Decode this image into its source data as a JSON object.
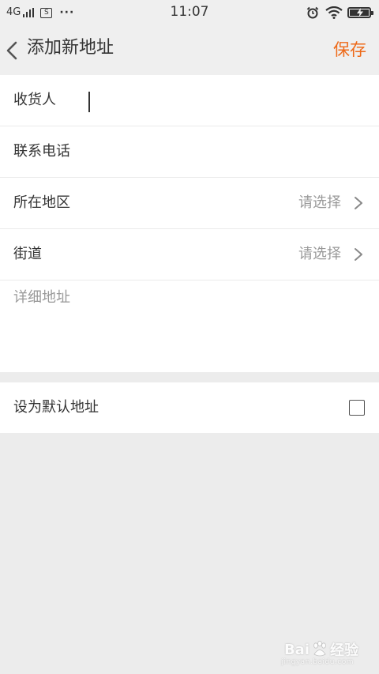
{
  "status_bar": {
    "network": "4G",
    "time": "11:07"
  },
  "header": {
    "title": "添加新地址",
    "save_label": "保存",
    "accent_color": "#ee6a19"
  },
  "form": {
    "fields": [
      {
        "label": "收货人",
        "value": ""
      },
      {
        "label": "联系电话",
        "value": ""
      },
      {
        "label": "所在地区",
        "value": "请选择"
      },
      {
        "label": "街道",
        "value": "请选择"
      }
    ],
    "detail_placeholder": "详细地址",
    "default_label": "设为默认地址",
    "default_checked": false
  },
  "icons": {
    "back": "chevron-left-icon",
    "row_arrow": "chevron-right-icon",
    "alarm": "alarm-icon",
    "wifi": "wifi-icon",
    "battery": "battery-charging-icon"
  },
  "watermark": {
    "brand_left": "Bai",
    "brand_right": "经验",
    "site": "jingyan.baidu.com"
  }
}
